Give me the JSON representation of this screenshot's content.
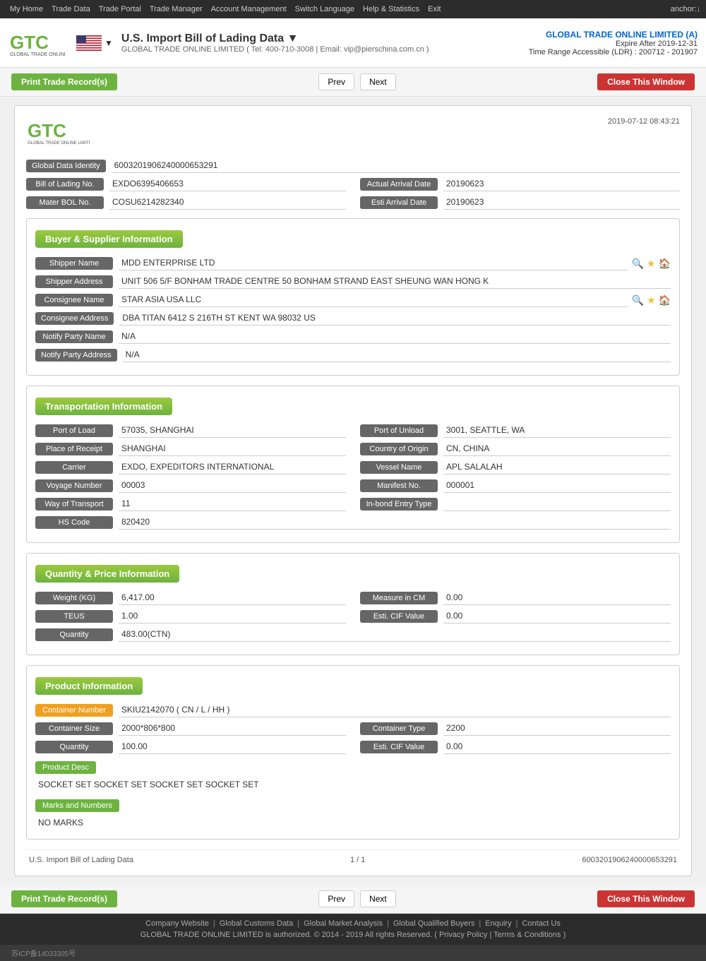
{
  "topnav": {
    "items": [
      "My Home",
      "Trade Data",
      "Trade Portal",
      "Trade Manager",
      "Account Management",
      "Switch Language",
      "Help & Statistics",
      "Exit"
    ],
    "user": "anchor:↓"
  },
  "header": {
    "title": "U.S. Import Bill of Lading Data ▼",
    "subtitle": "GLOBAL TRADE ONLINE LIMITED ( Tel: 400-710-3008 | Email: vip@pierschina.com.cn )",
    "company": "GLOBAL TRADE ONLINE LIMITED (A)",
    "expire": "Expire After 2019-12-31",
    "ldr": "Time Range Accessible (LDR) : 200712 - 201907"
  },
  "buttons": {
    "print": "Print Trade Record(s)",
    "prev": "Prev",
    "next": "Next",
    "close": "Close This Window"
  },
  "record": {
    "timestamp": "2019-07-12  08:43:21",
    "global_data_identity_label": "Global Data Identity",
    "global_data_identity": "6003201906240000653291",
    "bol_no_label": "Bill of Lading No.",
    "bol_no": "EXDO6395406653",
    "actual_arrival_date_label": "Actual Arrival Date",
    "actual_arrival_date": "20190623",
    "master_bol_label": "Mater BOL No.",
    "master_bol": "COSU6214282340",
    "esti_arrival_label": "Esti Arrival Date",
    "esti_arrival": "20190623"
  },
  "buyer_supplier": {
    "section_title": "Buyer & Supplier Information",
    "shipper_name_label": "Shipper Name",
    "shipper_name": "MDD ENTERPRISE LTD",
    "shipper_address_label": "Shipper Address",
    "shipper_address": "UNIT 506 5/F BONHAM TRADE CENTRE 50 BONHAM STRAND EAST SHEUNG WAN HONG K",
    "consignee_name_label": "Consignee Name",
    "consignee_name": "STAR ASIA USA LLC",
    "consignee_address_label": "Consignee Address",
    "consignee_address": "DBA TITAN 6412 S 216TH ST KENT WA 98032 US",
    "notify_party_name_label": "Notify Party Name",
    "notify_party_name": "N/A",
    "notify_party_address_label": "Notify Party Address",
    "notify_party_address": "N/A"
  },
  "transportation": {
    "section_title": "Transportation Information",
    "port_of_load_label": "Port of Load",
    "port_of_load": "57035, SHANGHAI",
    "port_of_unload_label": "Port of Unload",
    "port_of_unload": "3001, SEATTLE, WA",
    "place_of_receipt_label": "Place of Receipt",
    "place_of_receipt": "SHANGHAI",
    "country_of_origin_label": "Country of Origin",
    "country_of_origin": "CN, CHINA",
    "carrier_label": "Carrier",
    "carrier": "EXDO, EXPEDITORS INTERNATIONAL",
    "vessel_name_label": "Vessel Name",
    "vessel_name": "APL SALALAH",
    "voyage_number_label": "Voyage Number",
    "voyage_number": "00003",
    "manifest_no_label": "Manifest No.",
    "manifest_no": "000001",
    "way_of_transport_label": "Way of Transport",
    "way_of_transport": "11",
    "inbond_entry_type_label": "In-bond Entry Type",
    "inbond_entry_type": "",
    "hs_code_label": "HS Code",
    "hs_code": "820420"
  },
  "quantity_price": {
    "section_title": "Quantity & Price Information",
    "weight_label": "Weight (KG)",
    "weight": "6,417.00",
    "measure_in_cm_label": "Measure in CM",
    "measure_in_cm": "0.00",
    "teus_label": "TEUS",
    "teus": "1.00",
    "esti_cif_label": "Esti. CIF Value",
    "esti_cif": "0.00",
    "quantity_label": "Quantity",
    "quantity": "483.00(CTN)"
  },
  "product": {
    "section_title": "Product Information",
    "container_number_label": "Container Number",
    "container_number": "SKIU2142070 ( CN / L / HH )",
    "container_size_label": "Container Size",
    "container_size": "2000*806*800",
    "container_type_label": "Container Type",
    "container_type": "2200",
    "quantity_label": "Quantity",
    "quantity": "100.00",
    "esti_cif_label": "Esti. CIF Value",
    "esti_cif": "0.00",
    "product_desc_label": "Product Desc",
    "product_desc": "SOCKET SET SOCKET SET SOCKET SET SOCKET SET",
    "marks_and_numbers_label": "Marks and Numbers",
    "marks_and_numbers": "NO MARKS"
  },
  "record_footer": {
    "source": "U.S. Import Bill of Lading Data",
    "page": "1 / 1",
    "id": "6003201906240000653291"
  },
  "footer": {
    "links": [
      "Company Website",
      "Global Customs Data",
      "Global Market Analysis",
      "Global Qualified Buyers",
      "Enquiry",
      "Contact Us"
    ],
    "copyright": "GLOBAL TRADE ONLINE LIMITED is authorized. © 2014 - 2019 All rights Reserved.  ( Privacy Policy | Terms & Conditions )",
    "icp": "苏ICP备14033305号"
  }
}
